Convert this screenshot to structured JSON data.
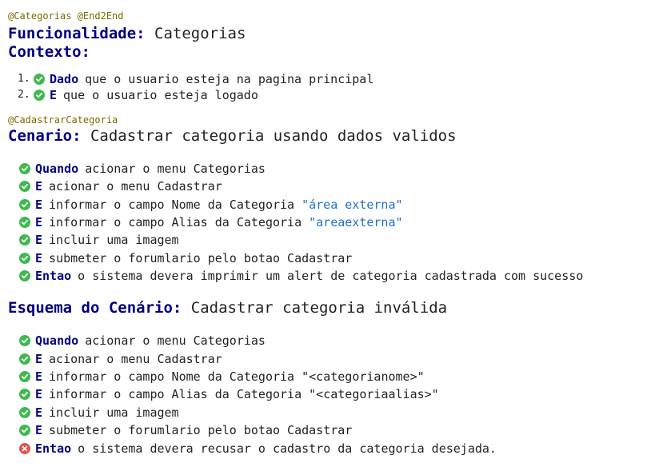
{
  "feature": {
    "tags": "@Categorias @End2End",
    "keyword": "Funcionalidade:",
    "name": "Categorias"
  },
  "background": {
    "keyword": "Contexto:",
    "steps": [
      {
        "number": "1.",
        "status": "passed",
        "keyword": "Dado",
        "text": "que o usuario esteja na pagina principal"
      },
      {
        "number": "2.",
        "status": "passed",
        "keyword": "E",
        "text": "que o usuario esteja logado"
      }
    ]
  },
  "scenario": {
    "tag": "@CadastrarCategoria",
    "keyword": "Cenario:",
    "name": "Cadastrar categoria usando dados validos",
    "steps": [
      {
        "status": "passed",
        "keyword": "Quando",
        "text": "acionar o menu Categorias",
        "arg": ""
      },
      {
        "status": "passed",
        "keyword": "E",
        "text": "acionar o menu Cadastrar",
        "arg": ""
      },
      {
        "status": "passed",
        "keyword": "E",
        "text": "informar o campo Nome da Categoria",
        "arg": "\"área externa\""
      },
      {
        "status": "passed",
        "keyword": "E",
        "text": "informar o campo Alias da Categoria",
        "arg": "\"areaexterna\""
      },
      {
        "status": "passed",
        "keyword": "E",
        "text": "incluir uma imagem",
        "arg": ""
      },
      {
        "status": "passed",
        "keyword": "E",
        "text": "submeter o forumlario pelo botao Cadastrar",
        "arg": ""
      },
      {
        "status": "passed",
        "keyword": "Entao",
        "text": "o sistema devera imprimir um alert de categoria cadastrada com sucesso",
        "arg": ""
      }
    ]
  },
  "outline": {
    "keyword": "Esquema do Cenário:",
    "name": "Cadastrar categoria inválida",
    "steps": [
      {
        "status": "passed",
        "keyword": "Quando",
        "text": "acionar o menu Categorias"
      },
      {
        "status": "passed",
        "keyword": "E",
        "text": "acionar o menu Cadastrar"
      },
      {
        "status": "passed",
        "keyword": "E",
        "text": "informar o campo Nome da Categoria \"<categorianome>\""
      },
      {
        "status": "passed",
        "keyword": "E",
        "text": "informar o campo Alias da Categoria \"<categoriaalias>\""
      },
      {
        "status": "passed",
        "keyword": "E",
        "text": "incluir uma imagem"
      },
      {
        "status": "passed",
        "keyword": "E",
        "text": "submeter o forumlario pelo botao Cadastrar"
      },
      {
        "status": "failed",
        "keyword": "Entao",
        "text": "o sistema devera recusar o cadastro da categoria desejada."
      }
    ]
  },
  "colors": {
    "keyword": "#000080",
    "tag": "#7a6a00",
    "argument": "#1f6fcc",
    "passed": "#3fb950",
    "failed": "#e5534b"
  },
  "icons": {
    "passed": "check-circle-icon",
    "failed": "x-circle-icon"
  }
}
